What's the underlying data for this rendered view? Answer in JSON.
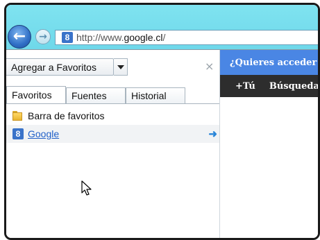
{
  "browser": {
    "address": {
      "url_prefix": "http://www.",
      "url_domain": "google.cl",
      "url_suffix": "/",
      "favicon_letter": "8"
    },
    "nav": {
      "back_icon": "arrow-left-icon",
      "forward_icon": "arrow-right-icon"
    }
  },
  "favorites_panel": {
    "add_button_label": "Agregar a Favoritos",
    "close_label": "×",
    "tabs": [
      {
        "label": "Favoritos",
        "active": true
      },
      {
        "label": "Fuentes",
        "active": false
      },
      {
        "label": "Historial",
        "active": false
      }
    ],
    "items": [
      {
        "type": "folder",
        "label": "Barra de favoritos",
        "icon": "folder-icon"
      },
      {
        "type": "link",
        "label": "Google",
        "icon": "google-favicon-icon",
        "favicon_letter": "8",
        "go_icon": "go-arrow-icon"
      }
    ]
  },
  "web_page": {
    "promo_text": "¿Quieres acceder",
    "top_links": [
      "+Tú",
      "Búsqueda"
    ]
  },
  "colors": {
    "chrome": "#6fd8ea",
    "promo_bar": "#4a86e4",
    "black_bar": "#2d2d2d",
    "link": "#1f5fc8",
    "go_arrow": "#2a86d8"
  }
}
